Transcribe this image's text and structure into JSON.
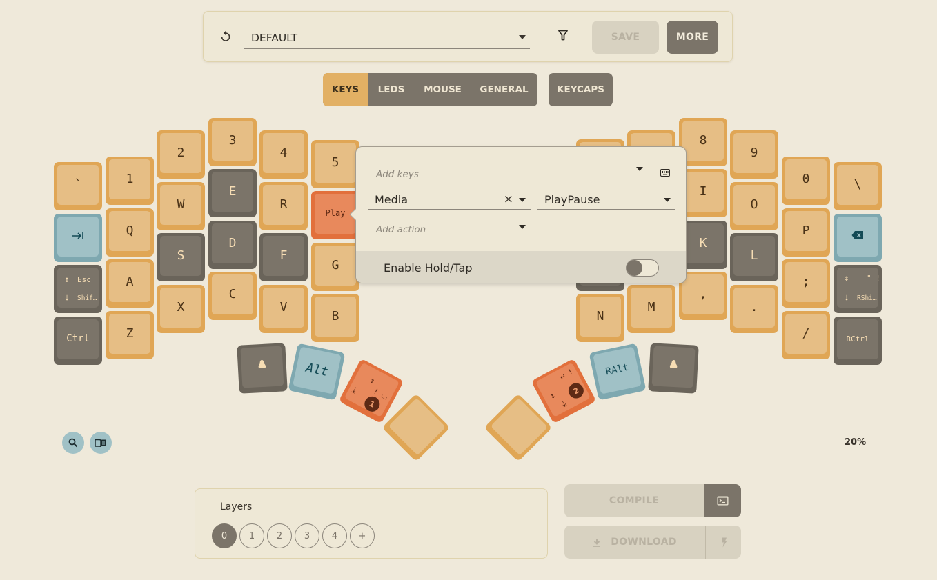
{
  "toolbar": {
    "reset_icon": "reset-icon",
    "profile_select": "DEFAULT",
    "filter_icon": "filter-icon",
    "save_label": "SAVE",
    "more_label": "MORE"
  },
  "tabs": [
    {
      "label": "KEYS",
      "active": true
    },
    {
      "label": "LEDS",
      "active": false
    },
    {
      "label": "MOUSE",
      "active": false
    },
    {
      "label": "GENERAL",
      "active": false
    }
  ],
  "keycaps_tab": {
    "label": "KEYCAPS"
  },
  "keyboard": {
    "left": {
      "col0": [
        "`",
        "tab-icon",
        {
          "hold": "Shif…",
          "tap": "Esc"
        },
        "Ctrl"
      ],
      "col1": [
        "1",
        "Q",
        "A",
        "Z"
      ],
      "col2": [
        "2",
        "W",
        "S",
        "X"
      ],
      "col3": [
        "3",
        "E",
        "D",
        "C"
      ],
      "col4": [
        "4",
        "R",
        "F",
        "V"
      ],
      "col5": [
        "5",
        "Play",
        "G",
        "B"
      ]
    },
    "right": {
      "col0": [
        "",
        "",
        "",
        "N"
      ],
      "col1": [
        "",
        "",
        "",
        "M"
      ],
      "col2": [
        "8",
        "I",
        "K",
        ","
      ],
      "col3": [
        "9",
        "O",
        "L",
        "."
      ],
      "col4": [
        "0",
        "P",
        ";",
        "/"
      ],
      "col5": [
        "\\",
        "backspace-icon",
        {
          "hold": "RShi…",
          "tap": "\" !"
        },
        "RCtrl"
      ]
    },
    "thumbs_left": [
      "linux-icon",
      "Alt",
      {
        "layer": "1"
      },
      ""
    ],
    "thumbs_right": [
      "",
      {
        "layer": "2"
      },
      "RAlt",
      "linux-icon"
    ],
    "labels": {
      "k_backtick": "`",
      "k_1": "1",
      "k_2": "2",
      "k_3": "3",
      "k_4": "4",
      "k_5": "5",
      "k_q": "Q",
      "k_w": "W",
      "k_e": "E",
      "k_r": "R",
      "k_play": "Play",
      "k_a": "A",
      "k_s": "S",
      "k_d": "D",
      "k_f": "F",
      "k_g": "G",
      "k_z": "Z",
      "k_x": "X",
      "k_c": "C",
      "k_v": "V",
      "k_b": "B",
      "k_esc": "Esc",
      "k_shift": "Shif…",
      "k_ctrl": "Ctrl",
      "k_8": "8",
      "k_9": "9",
      "k_0": "0",
      "k_backslash": "\\",
      "k_i": "I",
      "k_o": "O",
      "k_p": "P",
      "k_k": "K",
      "k_l": "L",
      "k_semicolon": ";",
      "k_n": "N",
      "k_m": "M",
      "k_comma": ",",
      "k_period": ".",
      "k_slash": "/",
      "k_quote": "\" !",
      "k_rshift": "RShi…",
      "k_rctrl": "RCtrl",
      "k_alt": "Alt",
      "k_ralt": "RAlt",
      "layer1": "1",
      "layer2": "2",
      "thumb1_tap": "! ⌴",
      "thumb2_tap": "↵ !"
    }
  },
  "popup": {
    "add_keys_placeholder": "Add keys",
    "category_value": "Media",
    "action_value": "PlayPause",
    "add_action_placeholder": "Add action",
    "hold_tap_label": "Enable Hold/Tap",
    "hold_tap_enabled": false
  },
  "zoom_level": "20%",
  "layers": {
    "title": "Layers",
    "items": [
      "0",
      "1",
      "2",
      "3",
      "4"
    ],
    "active": "0",
    "add_label": "+"
  },
  "compile": {
    "label": "COMPILE"
  },
  "download": {
    "label": "DOWNLOAD"
  },
  "colors": {
    "background": "#efe9da",
    "key_orange": "#e6be85",
    "key_gray": "#7b7469",
    "key_blue": "#a0c1c6",
    "key_selected": "#e8895c",
    "accent_tab": "#e2b064"
  }
}
